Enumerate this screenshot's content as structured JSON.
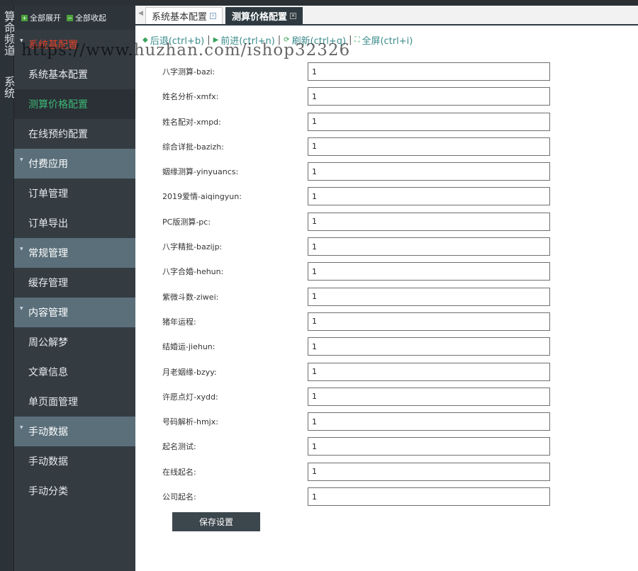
{
  "vertical_nav": {
    "channel": "算命频道",
    "system": "系统"
  },
  "sidebar": {
    "expand_all": "全部展开",
    "collapse_all": "全部收起",
    "groups": [
      {
        "title": "系统基配置",
        "items": [
          "系统基本配置",
          "测算价格配置",
          "在线预约配置"
        ]
      },
      {
        "title": "付费应用",
        "items": [
          "订单管理",
          "订单导出"
        ]
      },
      {
        "title": "常规管理",
        "items": [
          "缓存管理"
        ]
      },
      {
        "title": "内容管理",
        "items": [
          "周公解梦",
          "文章信息",
          "单页面管理"
        ]
      },
      {
        "title": "手动数据",
        "items": [
          "手动数据",
          "手动分类"
        ]
      }
    ]
  },
  "tabs": [
    {
      "label": "系统基本配置"
    },
    {
      "label": "测算价格配置"
    }
  ],
  "toolbar": {
    "back": "后退(ctrl+b)",
    "forward": "前进(ctrl+n)",
    "refresh": "刷新(ctrl+q)",
    "fullscreen": "全屏(ctrl+i)"
  },
  "watermark": "https://www.huzhan.com/ishop32326",
  "fields": [
    {
      "label": "八字测算-bazi:",
      "value": "1"
    },
    {
      "label": "姓名分析-xmfx:",
      "value": "1"
    },
    {
      "label": "姓名配对-xmpd:",
      "value": "1"
    },
    {
      "label": "综合详批-bazizh:",
      "value": "1"
    },
    {
      "label": "姻缘测算-yinyuancs:",
      "value": "1"
    },
    {
      "label": "2019爱情-aiqingyun:",
      "value": "1"
    },
    {
      "label": "PC版测算-pc:",
      "value": "1"
    },
    {
      "label": "八字精批-bazijp:",
      "value": "1"
    },
    {
      "label": "八字合婚-hehun:",
      "value": "1"
    },
    {
      "label": "紫微斗数-ziwei:",
      "value": "1"
    },
    {
      "label": "猪年运程:",
      "value": "1"
    },
    {
      "label": "结婚运-jiehun:",
      "value": "1"
    },
    {
      "label": "月老姻缘-bzyy:",
      "value": "1"
    },
    {
      "label": "许愿点灯-xydd:",
      "value": "1"
    },
    {
      "label": "号码解析-hmjx:",
      "value": "1"
    },
    {
      "label": "起名测试:",
      "value": "1"
    },
    {
      "label": "在线起名:",
      "value": "1"
    },
    {
      "label": "公司起名:",
      "value": "1"
    }
  ],
  "save_label": "保存设置"
}
